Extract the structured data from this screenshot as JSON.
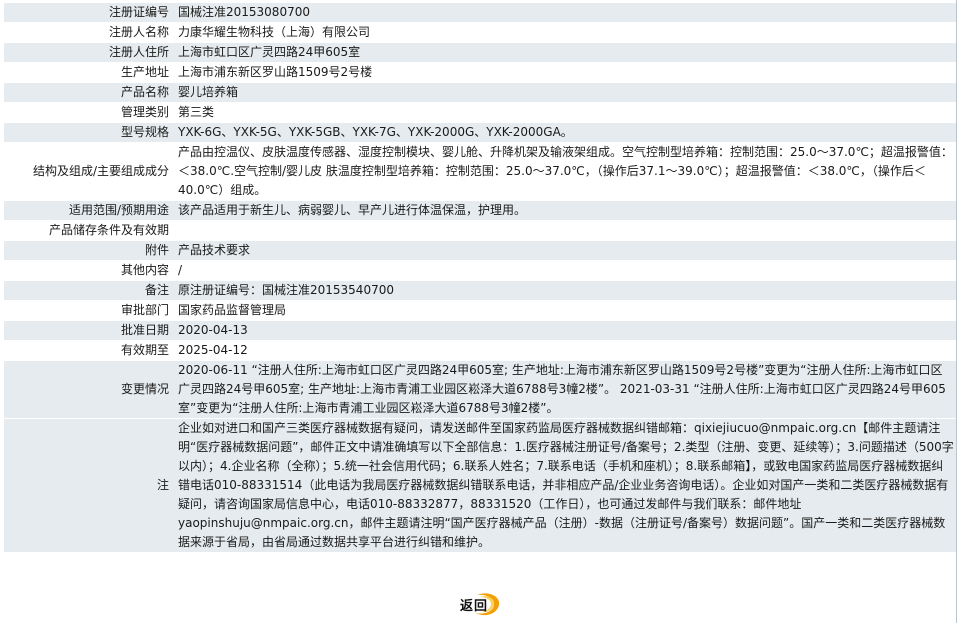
{
  "rows": [
    {
      "label": "注册证编号",
      "value": "国械注准20153080700"
    },
    {
      "label": "注册人名称",
      "value": "力康华耀生物科技（上海）有限公司"
    },
    {
      "label": "注册人住所",
      "value": "上海市虹口区广灵四路24甲605室"
    },
    {
      "label": "生产地址",
      "value": "上海市浦东新区罗山路1509号2号楼"
    },
    {
      "label": "产品名称",
      "value": "婴儿培养箱"
    },
    {
      "label": "管理类别",
      "value": "第三类"
    },
    {
      "label": "型号规格",
      "value": "YXK-6G、YXK-5G、YXK-5GB、YXK-7G、YXK-2000G、YXK-2000GA。"
    },
    {
      "label": "结构及组成/主要组成成分",
      "value": "产品由控温仪、皮肤温度传感器、湿度控制模块、婴儿舱、升降机架及输液架组成。空气控制型培养箱：控制范围：25.0～37.0℃；超温报警值：＜38.0℃.空气控制/婴儿皮 肤温度控制型培养箱：控制范围：25.0～37.0℃，（操作后37.1～39.0℃）；超温报警值：＜38.0℃，（操作后＜40.0℃）组成。"
    },
    {
      "label": "适用范围/预期用途",
      "value": "该产品适用于新生儿、病弱婴儿、早产儿进行体温保温，护理用。"
    },
    {
      "label": "产品储存条件及有效期",
      "value": ""
    },
    {
      "label": "附件",
      "value": "产品技术要求"
    },
    {
      "label": "其他内容",
      "value": "/"
    },
    {
      "label": "备注",
      "value": "原注册证编号：国械注准20153540700"
    },
    {
      "label": "审批部门",
      "value": "国家药品监督管理局"
    },
    {
      "label": "批准日期",
      "value": "2020-04-13"
    },
    {
      "label": "有效期至",
      "value": "2025-04-12"
    },
    {
      "label": "变更情况",
      "value": "2020-06-11 “注册人住所:上海市虹口区广灵四路24甲605室; 生产地址:上海市浦东新区罗山路1509号2号楼”变更为“注册人住所:上海市虹口区广灵四路24号甲605室; 生产地址:上海市青浦工业园区崧泽大道6788号3幢2楼”。 2021-03-31 “注册人住所:上海市虹口区广灵四路24号甲605室”变更为“注册人住所:上海市青浦工业园区崧泽大道6788号3幢2楼”。"
    },
    {
      "label": "注",
      "value": "企业如对进口和国产三类医疗器械数据有疑问，请发送邮件至国家药监局医疗器械数据纠错邮箱：qixiejiucuo@nmpaic.org.cn【邮件主题请注明“医疗器械数据问题”，邮件正文中请准确填写以下全部信息：1.医疗器械注册证号/备案号；2.类型（注册、变更、延续等）；3.问题描述（500字以内）；4.企业名称（全称）；5.统一社会信用代码；6.联系人姓名；7.联系电话（手机和座机）；8.联系邮箱】，或致电国家药监局医疗器械数据纠错电话010-88331514（此电话为我局医疗器械数据纠错联系电话，并非相应产品/企业业务咨询电话）。企业如对国产一类和二类医疗器械数据有疑问，请咨询国家局信息中心，电话010-88332877，88331520（工作日），也可通过发邮件与我们联系：邮件地址yaopinshuju@nmpaic.org.cn，邮件主题请注明“国产医疗器械产品（注册）-数据（注册证号/备案号）数据问题”。国产一类和二类医疗器械数据来源于省局，由省局通过数据共享平台进行纠错和维护。"
    }
  ],
  "back_button": {
    "label": "返回",
    "icon": "back-swoosh-icon",
    "accent": "#f2a007"
  }
}
